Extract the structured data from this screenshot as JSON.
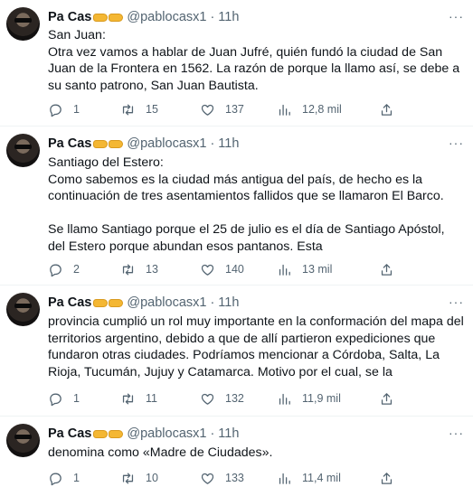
{
  "author": {
    "name": "Pa Cas",
    "handle": "@pablocasx1",
    "time": "11h"
  },
  "tweets": [
    {
      "text": "San Juan:\nOtra vez vamos a hablar de Juan Jufré, quién fundó la ciudad de San Juan de la Frontera en 1562. La razón de porque la llamo así, se debe a su santo patrono, San Juan Bautista.",
      "replies": "1",
      "retweets": "15",
      "likes": "137",
      "views": "12,8 mil"
    },
    {
      "text": "Santiago del Estero:\nComo sabemos es la ciudad más antigua del país, de hecho es la continuación de tres asentamientos fallidos que se llamaron El Barco.\n\nSe llamo Santiago porque el 25 de julio es el día de Santiago Apóstol, del Estero porque abundan esos pantanos. Esta",
      "replies": "2",
      "retweets": "13",
      "likes": "140",
      "views": "13 mil"
    },
    {
      "text": "provincia cumplió un rol muy importante en la conformación del mapa del territorios argentino, debido a que de allí partieron expediciones que fundaron otras ciudades.  Podríamos mencionar a Córdoba, Salta, La Rioja, Tucumán, Jujuy y Catamarca. Motivo por el cual, se la",
      "replies": "1",
      "retweets": "11",
      "likes": "132",
      "views": "11,9 mil"
    },
    {
      "text": "denomina como «Madre de Ciudades».",
      "replies": "1",
      "retweets": "10",
      "likes": "133",
      "views": "11,4 mil"
    }
  ],
  "icons": {
    "more": "more-icon",
    "reply": "reply-icon",
    "retweet": "retweet-icon",
    "like": "heart-icon",
    "views": "views-icon",
    "share": "share-icon"
  },
  "colors": {
    "text": "#0f1419",
    "secondary": "#536471",
    "divider": "#eff3f4"
  }
}
